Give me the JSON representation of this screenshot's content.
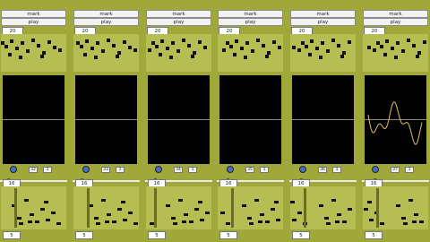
{
  "columns": [
    {
      "mark": "mark",
      "play": "play",
      "count": "20",
      "meter_a": "32",
      "meter_b": "1",
      "lower_value": "16",
      "bottom_value": "5",
      "has_wave": false
    },
    {
      "mark": "mark",
      "play": "play",
      "count": "20",
      "meter_a": "33",
      "meter_b": "1",
      "lower_value": "16",
      "bottom_value": "5",
      "has_wave": false
    },
    {
      "mark": "mark",
      "play": "play",
      "count": "20",
      "meter_a": "34",
      "meter_b": "1",
      "lower_value": "16",
      "bottom_value": "5",
      "has_wave": false
    },
    {
      "mark": "mark",
      "play": "play",
      "count": "20",
      "meter_a": "35",
      "meter_b": "1",
      "lower_value": "16",
      "bottom_value": "5",
      "has_wave": false
    },
    {
      "mark": "mark",
      "play": "play",
      "count": "20",
      "meter_a": "36",
      "meter_b": "1",
      "lower_value": "16",
      "bottom_value": "5",
      "has_wave": false
    },
    {
      "mark": "mark",
      "play": "play",
      "count": "20",
      "meter_a": "37",
      "meter_b": "1",
      "lower_value": "16",
      "bottom_value": "5",
      "has_wave": true
    }
  ],
  "colors": {
    "background": "#a1a83a",
    "panel": "#b6bd52",
    "scope": "#000000",
    "wave": "#e0c060"
  },
  "icons": {
    "speaker": "speaker-icon"
  }
}
